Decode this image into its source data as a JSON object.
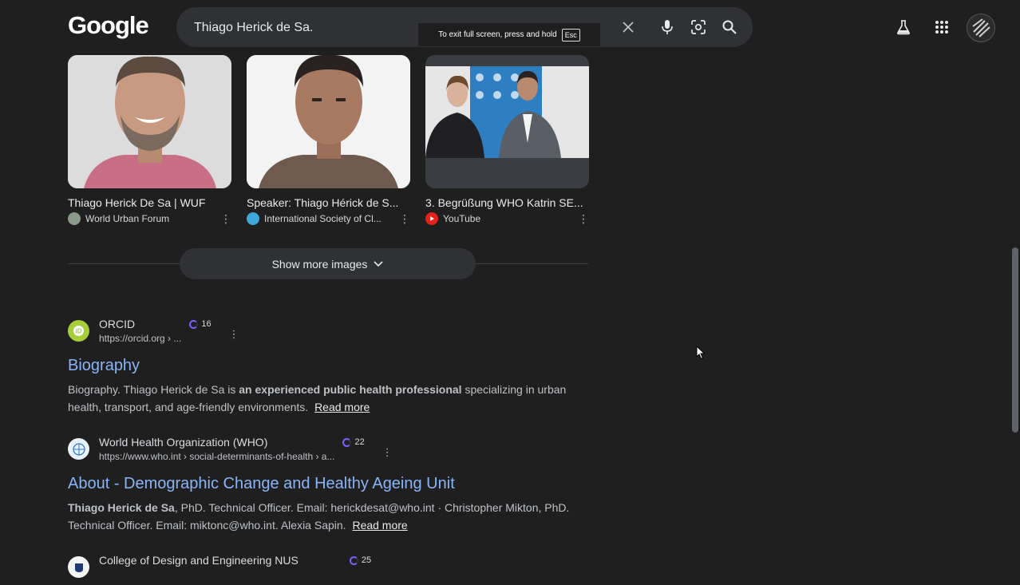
{
  "search": {
    "logo": "Google",
    "query": "Thiago Herick de Sa.",
    "fullscreen_tip": "To exit full screen, press and hold",
    "fullscreen_key": "Esc"
  },
  "images": [
    {
      "title": "Thiago Herick De Sa | WUF",
      "source": "World Urban Forum"
    },
    {
      "title": "Speaker: Thiago Hérick de S...",
      "source": "International Society of Cl..."
    },
    {
      "title": "3. Begrüßung WHO Katrin SE...",
      "source": "YouTube"
    }
  ],
  "show_more": "Show more images",
  "results": [
    {
      "site": "ORCID",
      "url": "https://orcid.org › ...",
      "badge": "16",
      "title": "Biography",
      "snippet_pre": "Biography. Thiago Herick de Sa is ",
      "snippet_bold": "an experienced public health professional",
      "snippet_post": " specializing in urban health, transport, and age-friendly environments.",
      "read_more": "Read more"
    },
    {
      "site": "World Health Organization (WHO)",
      "url": "https://www.who.int › social-determinants-of-health › a...",
      "badge": "22",
      "title": "About - Demographic Change and Healthy Ageing Unit",
      "snippet_bold": "Thiago Herick de Sa",
      "snippet_post": ", PhD. Technical Officer. Email: herickdesat@who.int · Christopher Mikton, PhD. Technical Officer. Email: miktonc@who.int. Alexia Sapin.",
      "read_more": "Read more"
    },
    {
      "site": "College of Design and Engineering NUS",
      "badge": "25"
    }
  ],
  "colors": {
    "background": "#1f1f1f",
    "link": "#8ab4f8",
    "searchbar": "#303134"
  }
}
